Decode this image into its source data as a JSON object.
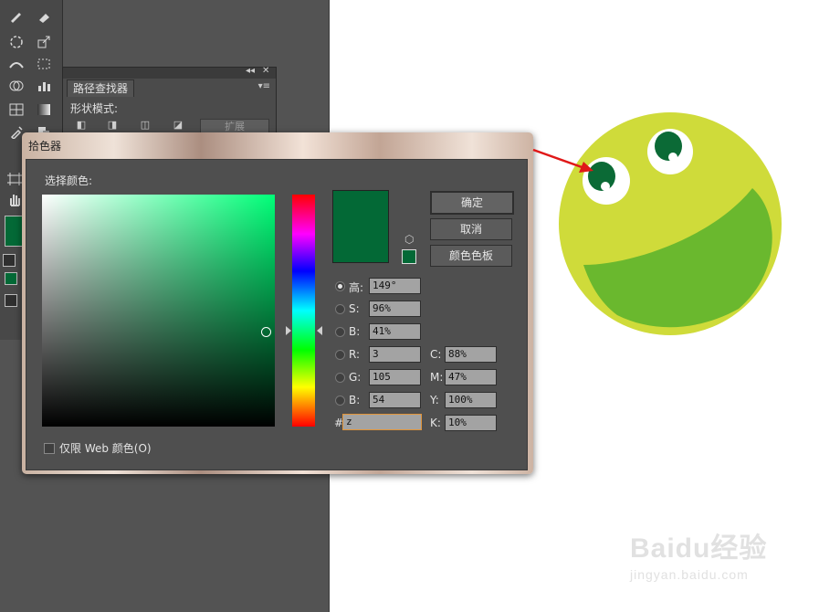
{
  "pathfinder": {
    "tab_label": "路径查找器",
    "section_label": "形状模式:",
    "expand_label": "扩展"
  },
  "picker": {
    "title": "拾色器",
    "select_color_label": "选择颜色:",
    "buttons": {
      "ok": "确定",
      "cancel": "取消",
      "swatches": "颜色色板"
    },
    "web_only_label": "仅限 Web 颜色(O)",
    "current_color": "#036936",
    "hsb": [
      {
        "label": "高:",
        "value": "149°",
        "selected": true
      },
      {
        "label": "S:",
        "value": "96%",
        "selected": false
      },
      {
        "label": "B:",
        "value": "41%",
        "selected": false
      }
    ],
    "rgb": [
      {
        "label": "R:",
        "value": "3"
      },
      {
        "label": "G:",
        "value": "105"
      },
      {
        "label": "B:",
        "value": "54"
      }
    ],
    "cmyk": [
      {
        "label": "C:",
        "value": "88%"
      },
      {
        "label": "M:",
        "value": "47%"
      },
      {
        "label": "Y:",
        "value": "100%"
      },
      {
        "label": "K:",
        "value": "10%"
      }
    ],
    "hex": {
      "label": "#",
      "value": "z"
    }
  },
  "watermark": {
    "brand": "Baidu经验",
    "url": "jingyan.baidu.com"
  },
  "colors": {
    "face": "#cfdb3a",
    "mouth": "#6ab82e",
    "eye_dark": "#0b6a36",
    "arrow": "#e01818"
  }
}
